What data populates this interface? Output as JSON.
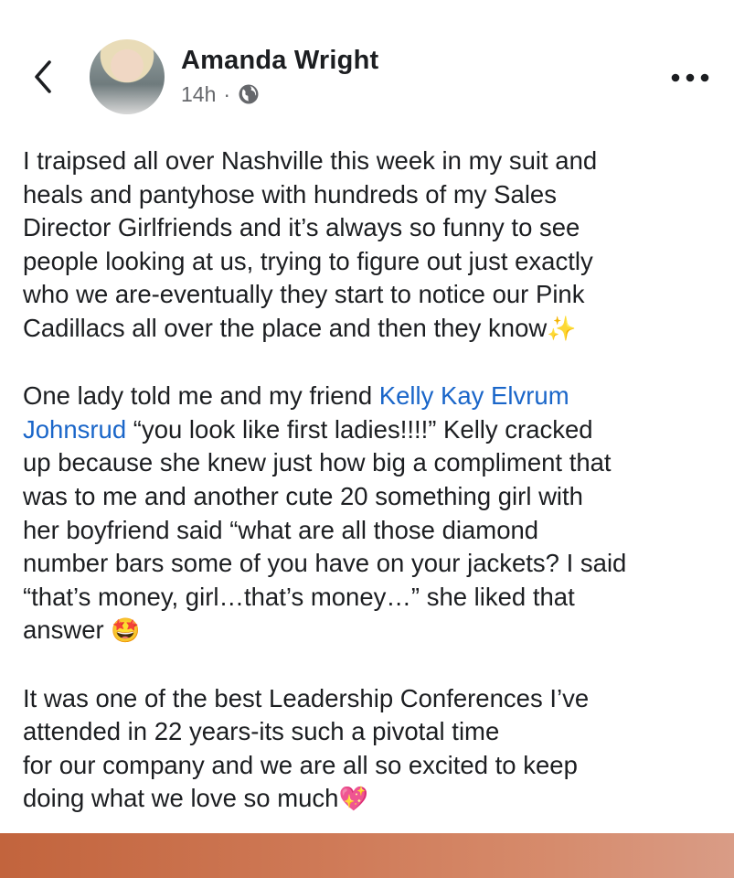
{
  "header": {
    "author": "Amanda Wright",
    "time": "14h",
    "separator": "·"
  },
  "icons": {
    "back": "chevron-left-icon",
    "more": "more-horizontal-icon",
    "audience": "globe-icon",
    "sparkles": "✨",
    "star_struck": "🤩",
    "sparkling_heart": "💖"
  },
  "post": {
    "p1_lines": [
      "I traipsed all over Nashville this week in my suit and",
      "heals and pantyhose with hundreds of my Sales",
      "Director Girlfriends and it’s always so funny to see",
      "people looking at us, trying to figure out just exactly",
      "who we are-eventually they start to notice our Pink",
      "Cadillacs all over the place and then they know"
    ],
    "p2_l1_prefix": "One lady told me and my friend ",
    "mention_l1": "Kelly Kay Elvrum",
    "mention_l2": "Johnsrud",
    "p2_l2_suffix": " “you look like first ladies!!!!” Kelly cracked",
    "p2_lines": [
      "up because she knew just how big a compliment that",
      "was to me and another cute 20 something girl with",
      "her boyfriend said “what are all those diamond",
      "number bars some of you have on your jackets? I said",
      "“that’s money, girl…that’s money…” she liked that"
    ],
    "p2_last": "answer",
    "p3_lines": [
      "It was one of the best Leadership Conferences I’ve",
      "attended in 22 years-its such a pivotal time",
      "for our company and we are all so excited to keep"
    ],
    "p3_last": "doing what we love so much"
  },
  "colors": {
    "mention": "#1a66c9",
    "text": "#1c1e21",
    "meta": "#65676b",
    "footer": "#c9704a"
  }
}
